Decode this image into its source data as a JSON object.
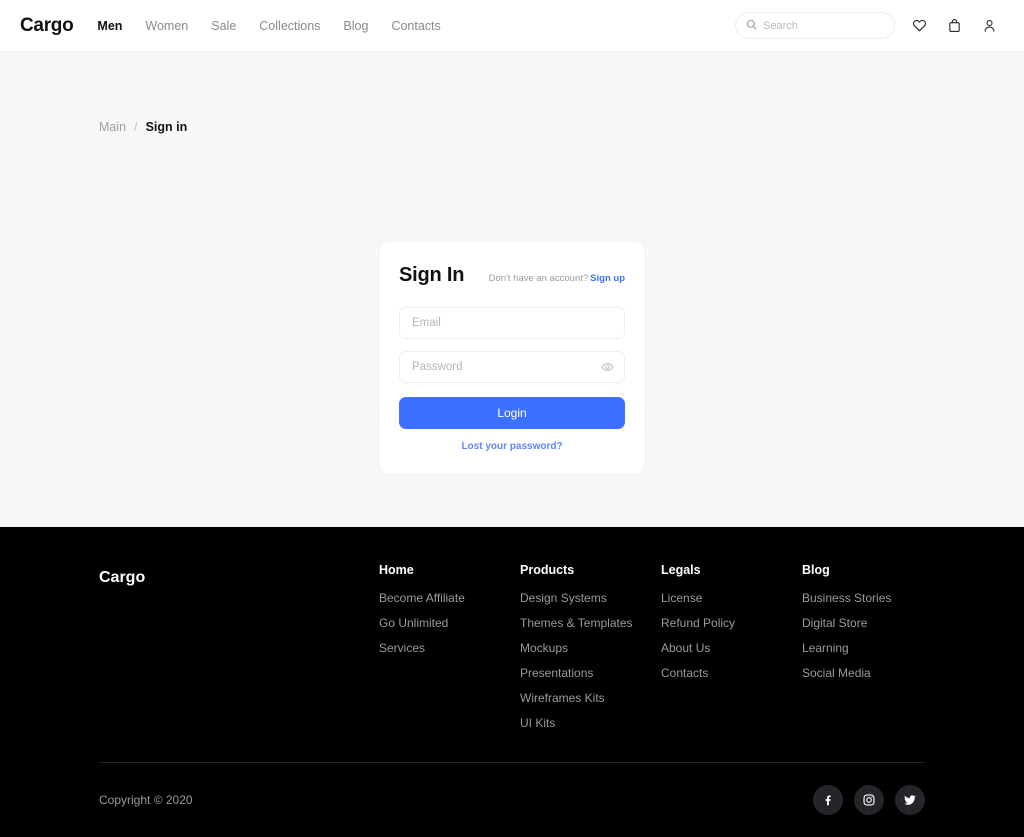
{
  "header": {
    "brand": "Cargo",
    "nav": [
      {
        "label": "Men",
        "active": true
      },
      {
        "label": "Women",
        "active": false
      },
      {
        "label": "Sale",
        "active": false
      },
      {
        "label": "Collections",
        "active": false
      },
      {
        "label": "Blog",
        "active": false
      },
      {
        "label": "Contacts",
        "active": false
      }
    ],
    "search": {
      "placeholder": "Search",
      "value": "",
      "icon": "search-icon"
    },
    "icons": [
      "heart-icon",
      "bag-icon",
      "user-icon"
    ]
  },
  "breadcrumb": {
    "parent": "Main",
    "separator": "/",
    "current": "Sign in"
  },
  "signin_card": {
    "title": "Sign In",
    "prompt": "Don't have an account?",
    "signup_label": "Sign up",
    "email": {
      "placeholder": "Email",
      "value": ""
    },
    "password": {
      "placeholder": "Password",
      "value": "",
      "toggle_icon": "eye-icon"
    },
    "login_label": "Login",
    "lost_password_label": "Lost your password?"
  },
  "footer": {
    "brand": "Cargo",
    "columns": [
      {
        "title": "Home",
        "links": [
          "Become Affiliate",
          "Go Unlimited",
          "Services"
        ]
      },
      {
        "title": "Products",
        "links": [
          "Design Systems",
          "Themes & Templates",
          "Mockups",
          "Presentations",
          "Wireframes Kits",
          "UI Kits"
        ]
      },
      {
        "title": "Legals",
        "links": [
          "License",
          "Refund Policy",
          "About Us",
          "Contacts"
        ]
      },
      {
        "title": "Blog",
        "links": [
          "Business Stories",
          "Digital Store",
          "Learning",
          "Social Media"
        ]
      }
    ],
    "copyright": "Copyright © 2020",
    "socials": [
      "facebook-icon",
      "instagram-icon",
      "twitter-icon"
    ]
  },
  "colors": {
    "accent": "#3b71fe",
    "link": "#5f86f8",
    "page_bg": "#f7f7f8",
    "footer_bg": "#000000"
  }
}
